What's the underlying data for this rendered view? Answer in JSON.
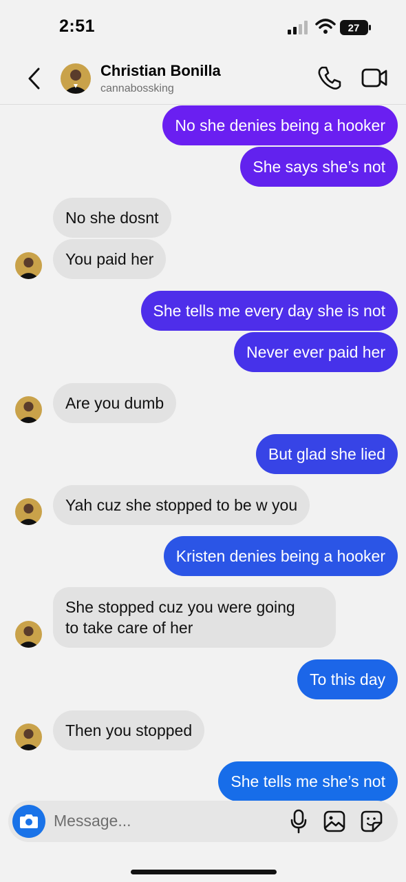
{
  "status_bar": {
    "time": "2:51",
    "battery": "27"
  },
  "header": {
    "name": "Christian Bonilla",
    "handle": "cannabossking"
  },
  "messages": [
    {
      "side": "out",
      "text": "No she denies being a hooker",
      "color": "#6a1ff1"
    },
    {
      "side": "out",
      "text": "She says she’s not",
      "color": "#6222ee"
    },
    {
      "side": "in",
      "text": "No she dosnt"
    },
    {
      "side": "in",
      "text": "You paid her"
    },
    {
      "side": "out",
      "text": "She tells me every day she is not",
      "color": "#4e2eea"
    },
    {
      "side": "out",
      "text": "Never ever paid her",
      "color": "#4632ea"
    },
    {
      "side": "in",
      "text": "Are you dumb"
    },
    {
      "side": "out",
      "text": "But glad she lied",
      "color": "#3744e6"
    },
    {
      "side": "in",
      "text": "Yah cuz she stopped to be w you"
    },
    {
      "side": "out",
      "text": "Kristen denies being a hooker",
      "color": "#2b55e6"
    },
    {
      "side": "in",
      "text": "She stopped cuz you were going\nto take care of her"
    },
    {
      "side": "out",
      "text": "To this day",
      "color": "#1c66e8"
    },
    {
      "side": "in",
      "text": "Then you stopped"
    },
    {
      "side": "out",
      "text": "She tells me she’s not",
      "color": "#176de9"
    }
  ],
  "composer": {
    "placeholder": "Message..."
  },
  "colors": {
    "camera": "#1a73e8",
    "incoming_bubble": "#e2e2e2"
  },
  "icons": [
    "back-chevron-icon",
    "phone-icon",
    "video-camera-icon",
    "camera-icon",
    "microphone-icon",
    "gallery-icon",
    "sticker-icon"
  ]
}
